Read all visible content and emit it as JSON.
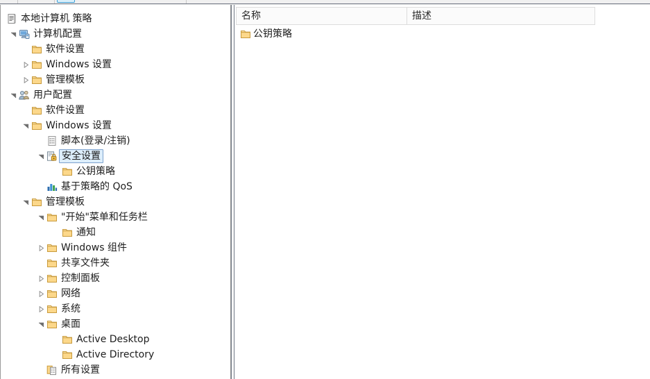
{
  "window": {
    "title": "本地计算机 策略"
  },
  "toolbar": {
    "active_button_name": "toolbar-button-active"
  },
  "tree": {
    "root": {
      "label": "本地计算机 策略",
      "icon": "policy-document-icon"
    },
    "items": [
      {
        "label": "本地计算机 策略",
        "level": 0,
        "icon": "policy-document-icon",
        "arrow": "none",
        "selected": false
      },
      {
        "label": "计算机配置",
        "level": 1,
        "icon": "computer-icon",
        "arrow": "expanded",
        "selected": false
      },
      {
        "label": "软件设置",
        "level": 2,
        "icon": "folder-icon",
        "arrow": "none",
        "selected": false
      },
      {
        "label": "Windows 设置",
        "level": 2,
        "icon": "folder-icon",
        "arrow": "collapsed",
        "selected": false
      },
      {
        "label": "管理模板",
        "level": 2,
        "icon": "folder-icon",
        "arrow": "collapsed",
        "selected": false
      },
      {
        "label": "用户配置",
        "level": 1,
        "icon": "users-icon",
        "arrow": "expanded",
        "selected": false
      },
      {
        "label": "软件设置",
        "level": 2,
        "icon": "folder-icon",
        "arrow": "none",
        "selected": false
      },
      {
        "label": "Windows 设置",
        "level": 2,
        "icon": "folder-icon",
        "arrow": "expanded",
        "selected": false
      },
      {
        "label": "脚本(登录/注销)",
        "level": 3,
        "icon": "script-icon",
        "arrow": "none",
        "selected": false
      },
      {
        "label": "安全设置",
        "level": 3,
        "icon": "security-lock-icon",
        "arrow": "expanded",
        "selected": true
      },
      {
        "label": "公钥策略",
        "level": 4,
        "icon": "folder-icon",
        "arrow": "none",
        "selected": false
      },
      {
        "label": "基于策略的 QoS",
        "level": 3,
        "icon": "qos-chart-icon",
        "arrow": "none",
        "selected": false
      },
      {
        "label": "管理模板",
        "level": 2,
        "icon": "folder-icon",
        "arrow": "expanded",
        "selected": false
      },
      {
        "label": "\"开始\"菜单和任务栏",
        "level": 3,
        "icon": "folder-icon",
        "arrow": "expanded",
        "selected": false
      },
      {
        "label": "通知",
        "level": 4,
        "icon": "folder-icon",
        "arrow": "none",
        "selected": false
      },
      {
        "label": "Windows 组件",
        "level": 3,
        "icon": "folder-icon",
        "arrow": "collapsed",
        "selected": false
      },
      {
        "label": "共享文件夹",
        "level": 3,
        "icon": "folder-icon",
        "arrow": "none",
        "selected": false
      },
      {
        "label": "控制面板",
        "level": 3,
        "icon": "folder-icon",
        "arrow": "collapsed",
        "selected": false
      },
      {
        "label": "网络",
        "level": 3,
        "icon": "folder-icon",
        "arrow": "collapsed",
        "selected": false
      },
      {
        "label": "系统",
        "level": 3,
        "icon": "folder-icon",
        "arrow": "collapsed",
        "selected": false
      },
      {
        "label": "桌面",
        "level": 3,
        "icon": "folder-icon",
        "arrow": "expanded",
        "selected": false
      },
      {
        "label": "Active Desktop",
        "level": 4,
        "icon": "folder-icon",
        "arrow": "none",
        "selected": false
      },
      {
        "label": "Active Directory",
        "level": 4,
        "icon": "folder-icon",
        "arrow": "none",
        "selected": false
      },
      {
        "label": "所有设置",
        "level": 3,
        "icon": "all-settings-icon",
        "arrow": "none",
        "selected": false
      }
    ]
  },
  "list": {
    "columns": [
      {
        "label": "名称"
      },
      {
        "label": "描述"
      }
    ],
    "rows": [
      {
        "name": "公钥策略",
        "description": "",
        "icon": "folder-icon"
      }
    ]
  },
  "colors": {
    "selection_fill": "#ddeefb",
    "selection_border": "#7da2ce",
    "folder_body": "#fcd88b",
    "folder_edge": "#d9a441",
    "header_bg": "#fbfbfb",
    "pane_border": "#6e7582",
    "text": "#1d1d1d"
  }
}
